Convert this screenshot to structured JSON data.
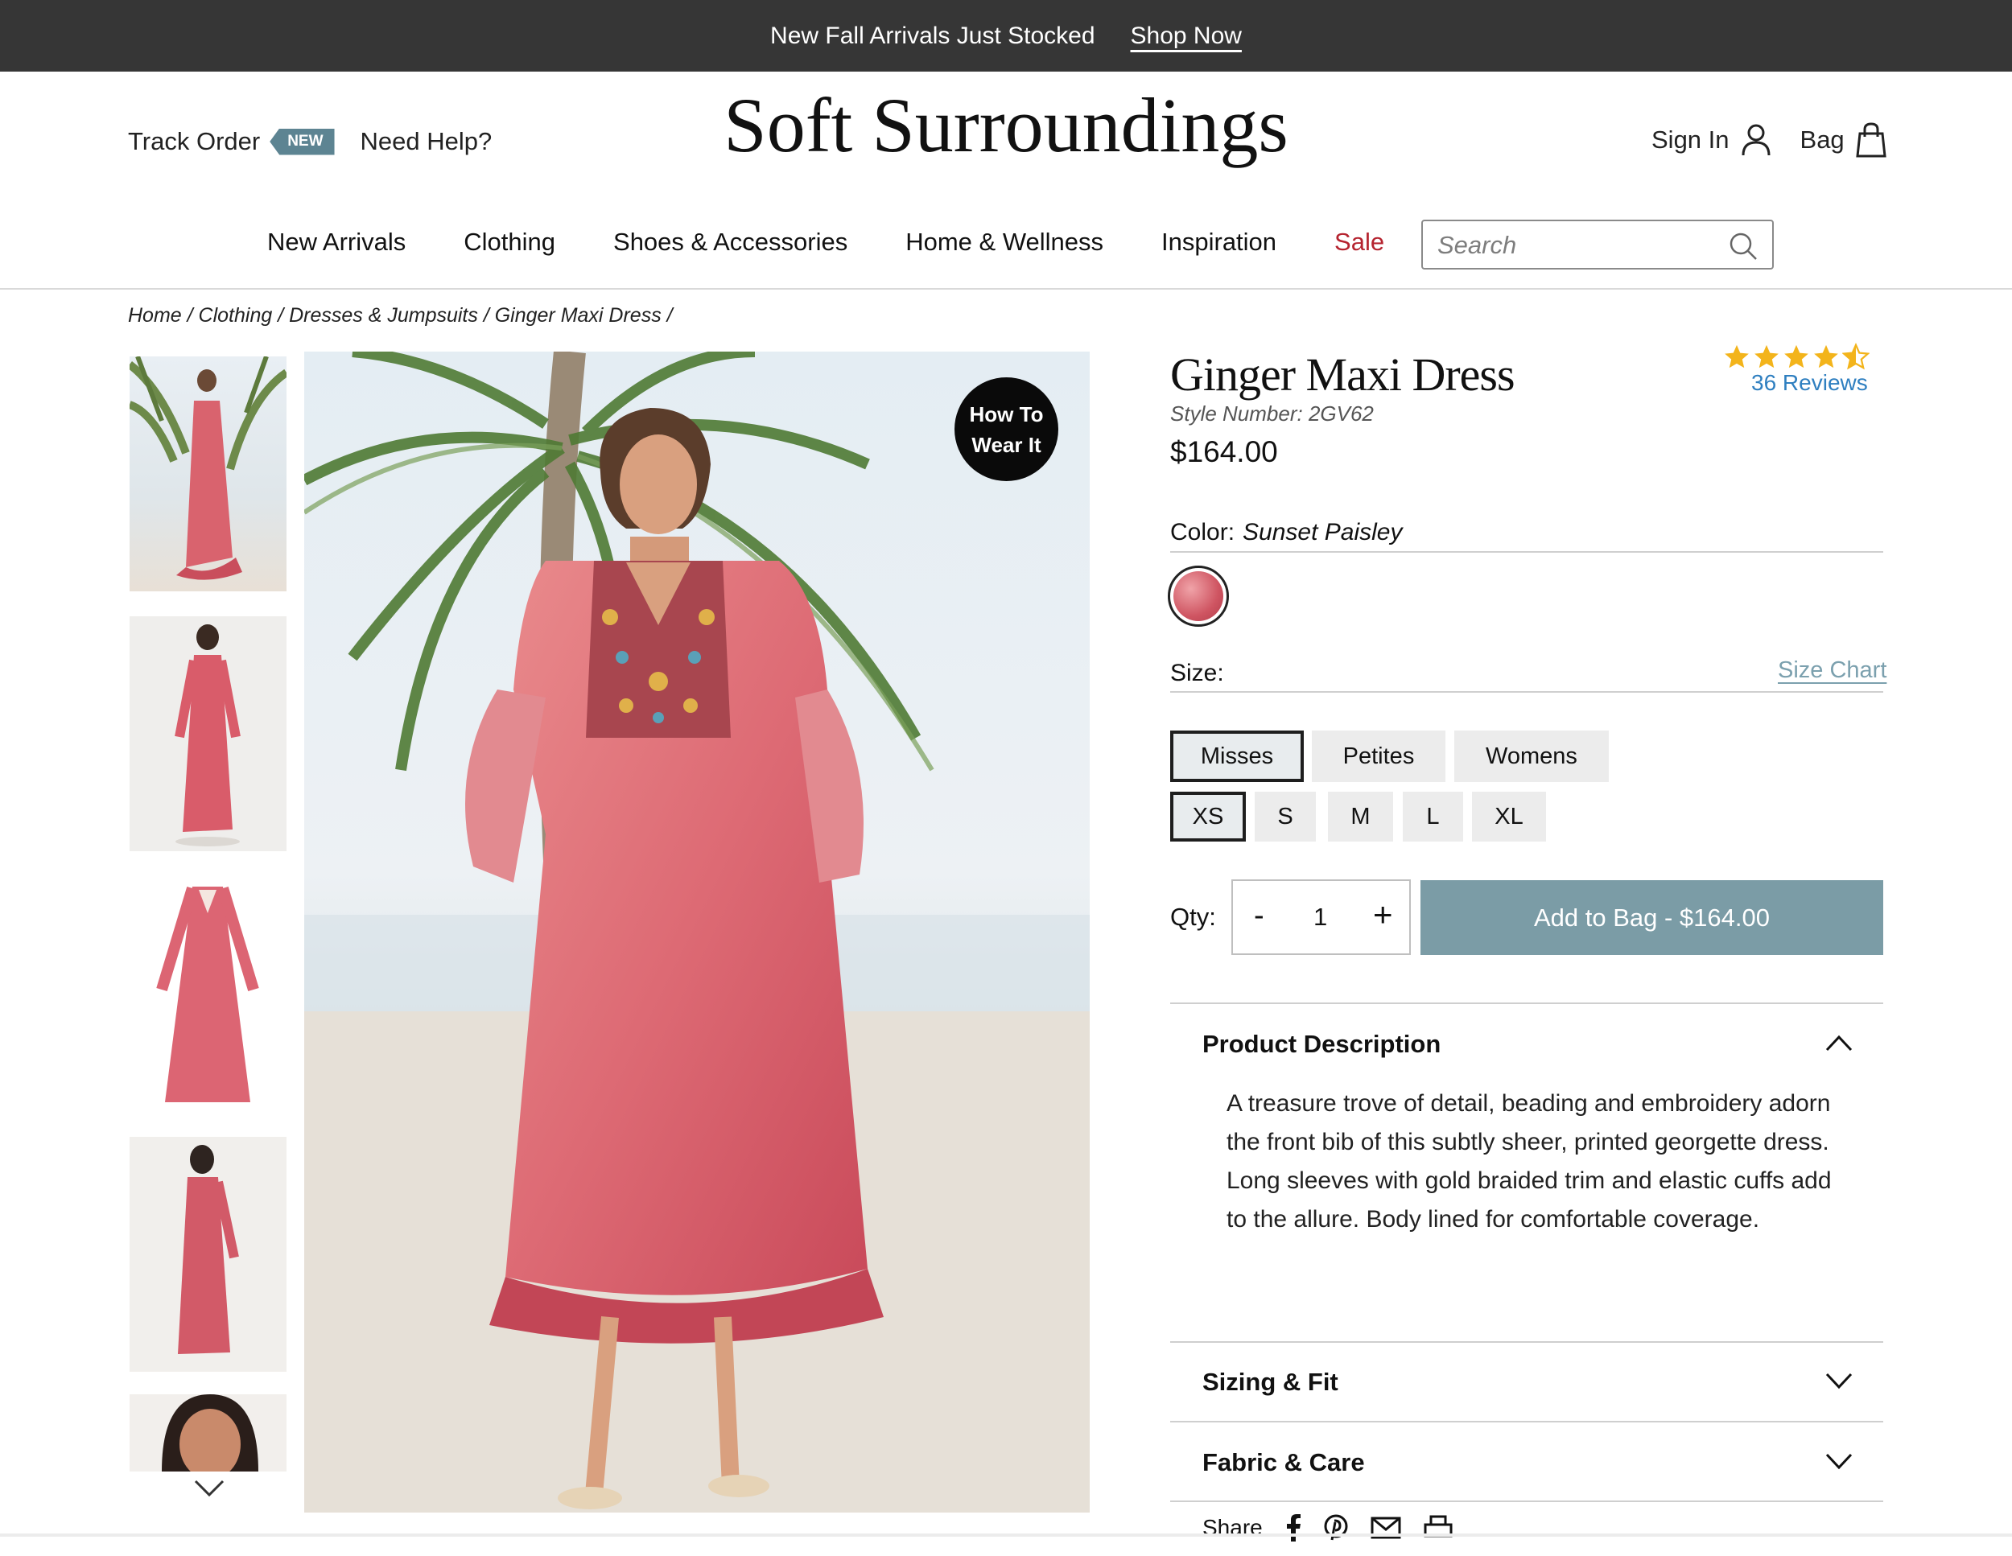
{
  "promo": {
    "text": "New Fall Arrivals Just Stocked",
    "link": "Shop Now"
  },
  "header": {
    "track_order": "Track Order",
    "new_badge": "NEW",
    "need_help": "Need Help?",
    "logo": "Soft Surroundings",
    "sign_in": "Sign In",
    "bag": "Bag"
  },
  "nav": {
    "items": [
      "New Arrivals",
      "Clothing",
      "Shoes & Accessories",
      "Home & Wellness",
      "Inspiration"
    ],
    "sale": "Sale",
    "search_placeholder": "Search"
  },
  "breadcrumb": "Home / Clothing / Dresses & Jumpsuits / Ginger Maxi Dress /",
  "gallery": {
    "how_to": [
      "How To",
      "Wear It"
    ]
  },
  "product": {
    "title": "Ginger Maxi Dress",
    "rating": 4.5,
    "reviews": "36 Reviews",
    "style_number": "Style Number: 2GV62",
    "price": "$164.00",
    "color_label": "Color:",
    "color_value": "Sunset Paisley",
    "size_label": "Size:",
    "size_chart": "Size Chart",
    "fits": [
      "Misses",
      "Petites",
      "Womens"
    ],
    "selected_fit": "Misses",
    "sizes": [
      "XS",
      "S",
      "M",
      "L",
      "XL"
    ],
    "selected_size": "XS",
    "qty_label": "Qty:",
    "qty_minus": "-",
    "qty_value": "1",
    "qty_plus": "+",
    "add_to_bag": "Add to Bag - $164.00"
  },
  "accordion": {
    "description_title": "Product Description",
    "description_text": "A treasure trove of detail, beading and embroidery adorn the front bib of this subtly sheer, printed georgette dress. Long sleeves with gold braided trim and elastic cuffs add to the allure. Body lined for comfortable coverage.",
    "sizing_title": "Sizing & Fit",
    "fabric_title": "Fabric & Care"
  },
  "share": {
    "label": "Share"
  },
  "colors": {
    "accent": "#7b9ca6",
    "sale": "#b5232f",
    "link": "#2f7fc0",
    "star": "#f3b41b",
    "promo_bg": "#363636"
  }
}
